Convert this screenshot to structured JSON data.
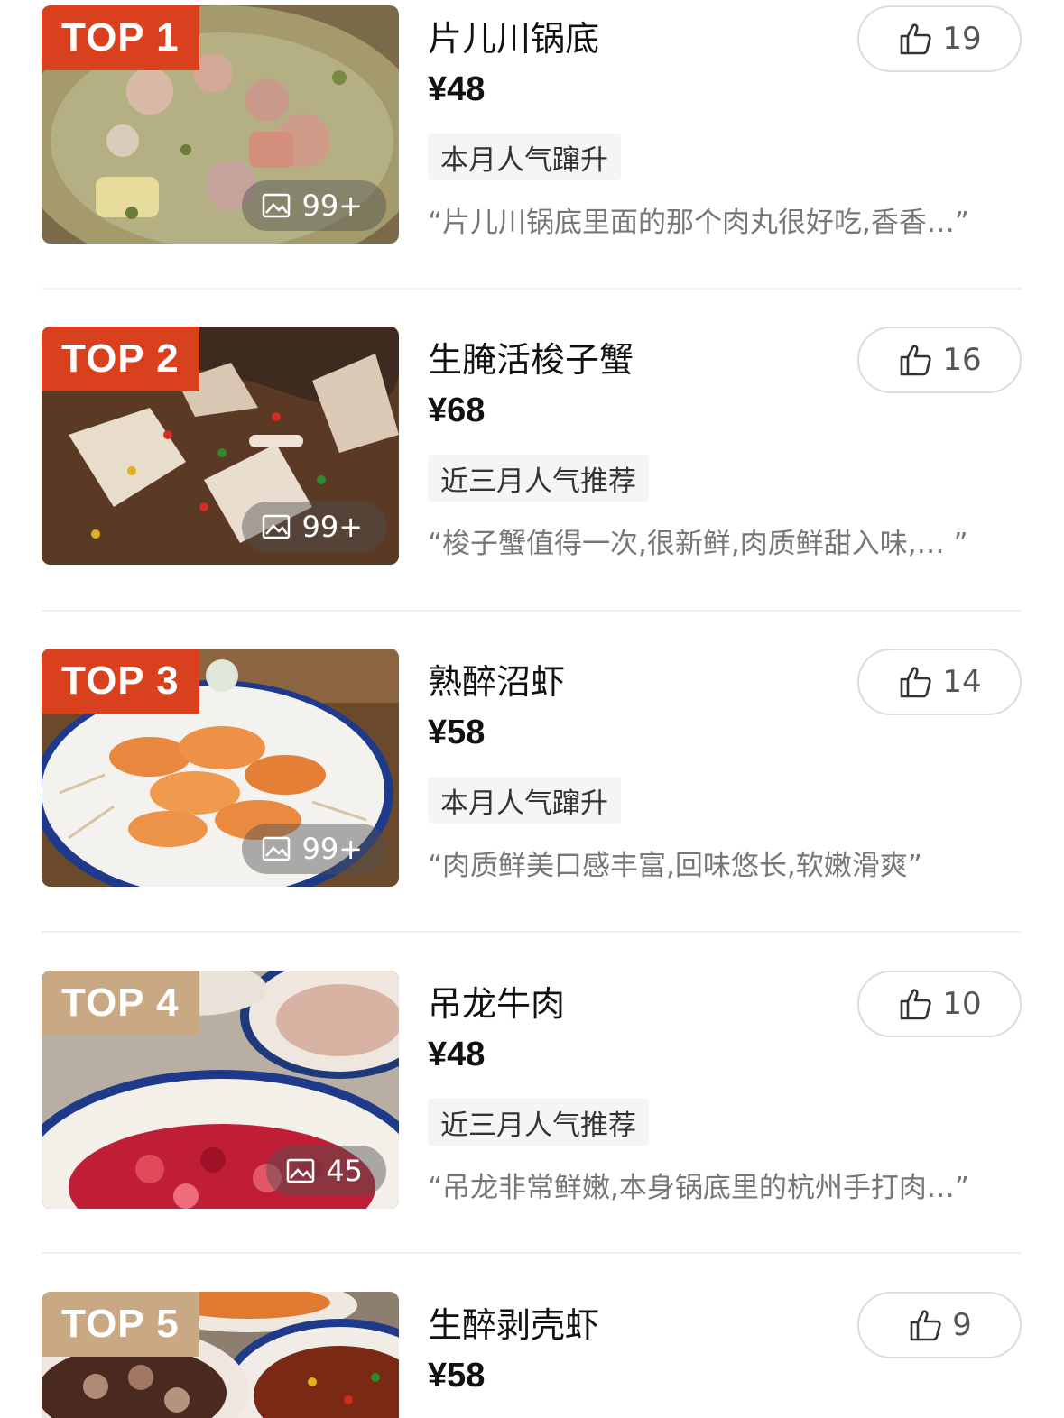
{
  "items": [
    {
      "rank": "TOP 1",
      "name": "片儿川锅底",
      "price": "¥48",
      "tag": "本月人气蹿升",
      "review": "“片儿川锅底里面的那个肉丸很好吃,香香…”",
      "likes": "19",
      "photo_count": "99+",
      "badge_color": "#d8401e"
    },
    {
      "rank": "TOP 2",
      "name": "生腌活梭子蟹",
      "price": "¥68",
      "tag": "近三月人气推荐",
      "review": "“梭子蟹值得一次,很新鲜,肉质鲜甜入味,… ”",
      "likes": "16",
      "photo_count": "99+",
      "badge_color": "#d8401e"
    },
    {
      "rank": "TOP 3",
      "name": "熟醉沼虾",
      "price": "¥58",
      "tag": "本月人气蹿升",
      "review": "“肉质鲜美口感丰富,回味悠长,软嫩滑爽”",
      "likes": "14",
      "photo_count": "99+",
      "badge_color": "#d8401e"
    },
    {
      "rank": "TOP 4",
      "name": "吊龙牛肉",
      "price": "¥48",
      "tag": "近三月人气推荐",
      "review": "“吊龙非常鲜嫩,本身锅底里的杭州手打肉…”",
      "likes": "10",
      "photo_count": "45",
      "badge_color": "#c9a884"
    },
    {
      "rank": "TOP 5",
      "name": "生醉剥壳虾",
      "price": "¥58",
      "likes": "9",
      "badge_color": "#c9a884"
    }
  ],
  "icons": {
    "like": "thumbs-up-icon",
    "photo": "image-icon"
  }
}
